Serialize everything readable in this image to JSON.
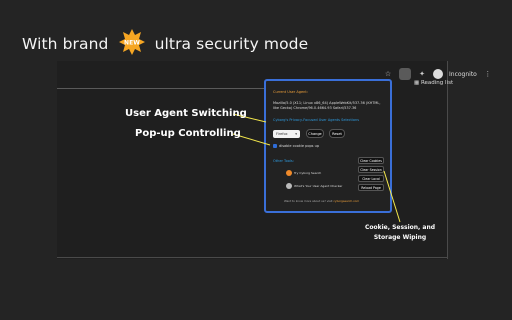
{
  "headline": {
    "before": "With brand",
    "badge": "NEW",
    "after": "ultra security mode"
  },
  "browser": {
    "profile": "Incognito",
    "reading_list": "Reading list"
  },
  "popup": {
    "title": "Current User Agent:",
    "ua_string": "Mozilla/5.0 (X11; Linux x86_64) AppleWebKit/537.36 (KHTML, like Gecko) Chrome/96.0.4664.93 Safari/537.36",
    "presets_title": "Cyborg's Privacy-Focused User Agents Selections",
    "select_value": "Firefox",
    "change_label": "Change",
    "reset_label": "Reset",
    "disable_popups_label": "disable cookie pops up",
    "other_tools": "Other Tools:",
    "tools": [
      "Try Cyborg Search",
      "What's Your User Agent Checker"
    ],
    "wipe_buttons": [
      "Clear Cookies",
      "Clear Session",
      "Clear Local",
      "Reload Page"
    ],
    "footer_text": "Want to know more about us? visit",
    "footer_link": "cyborgsearch.com"
  },
  "callouts": {
    "ua_switching": "User Agent Switching",
    "popup_controlling": "Pop-up Controlling",
    "wiping": "Cookie, Session, and Storage Wiping"
  },
  "colors": {
    "accent_blue": "#3a6fd8",
    "badge_orange": "#f6a623",
    "heading_orange": "#f0a13a",
    "link_blue": "#2e9ce0",
    "callout_line": "#f5e94c"
  }
}
